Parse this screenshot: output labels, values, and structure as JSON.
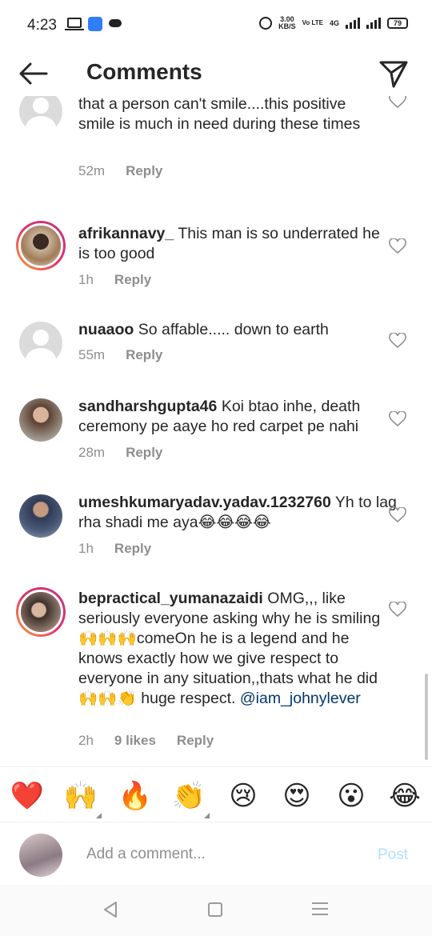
{
  "status_bar": {
    "time": "4:23",
    "speed_value": "3.00",
    "speed_unit": "KB/S",
    "volte": "Vo LTE",
    "network": "4G",
    "battery": "79"
  },
  "header": {
    "title": "Comments",
    "back_icon": "arrow-left-icon",
    "direct_icon": "paper-plane-icon"
  },
  "comments": [
    {
      "username": "",
      "text": "that a person can't smile....this positive smile is much in need during these times",
      "time": "52m",
      "likes": "",
      "reply": "Reply",
      "avatar": "placeholder"
    },
    {
      "username": "afrikannavy_",
      "text": "This man is so underrated he is too good",
      "time": "1h",
      "likes": "",
      "reply": "Reply",
      "avatar": "photo"
    },
    {
      "username": "nuaaoo",
      "text": "So affable..... down to earth",
      "time": "55m",
      "likes": "",
      "reply": "Reply",
      "avatar": "placeholder"
    },
    {
      "username": "sandharshgupta46",
      "text": "Koi btao inhe, death ceremony pe aaye ho red carpet pe nahi",
      "time": "28m",
      "likes": "",
      "reply": "Reply",
      "avatar": "photo"
    },
    {
      "username": "umeshkumaryadav.yadav.1232760",
      "text": "Yh to lag rha shadi me aya😂😂😂😂",
      "time": "1h",
      "likes": "",
      "reply": "Reply",
      "avatar": "photo"
    },
    {
      "username": "bepractical_yumanazaidi",
      "text": "OMG,,, like seriously everyone asking why he is smiling 🙌🙌🙌comeOn he is a legend and he knows exactly how we give respect to everyone in any situation,,thats what he did🙌🙌👏 huge respect.",
      "mention": "@iam_johnylever",
      "time": "2h",
      "likes": "9 likes",
      "reply": "Reply",
      "avatar": "photo"
    }
  ],
  "emoji_bar": [
    "❤️",
    "🙌",
    "🔥",
    "👏",
    "😢",
    "😍",
    "😮",
    "😂"
  ],
  "add_comment": {
    "placeholder": "Add a comment...",
    "post_label": "Post"
  },
  "colors": {
    "text": "#262626",
    "secondary": "#8e8e8e",
    "post_disabled": "#b2dffc",
    "mention": "#00376b"
  }
}
